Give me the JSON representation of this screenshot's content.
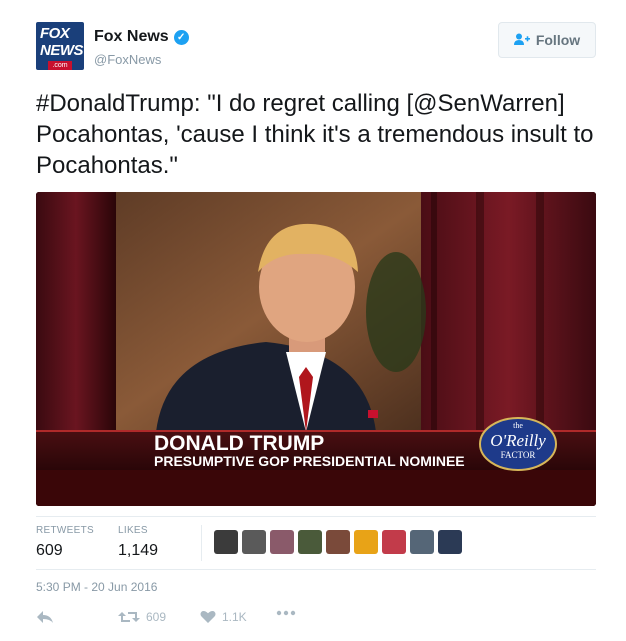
{
  "account": {
    "name": "Fox News",
    "handle": "@FoxNews",
    "logo_text": [
      "FOX",
      "NEWS",
      ".com"
    ]
  },
  "follow_label": "Follow",
  "tweet_text": "#DonaldTrump: \"I do regret calling [@SenWarren] Pocahontas, 'cause I think it's a tremendous insult to Pocahontas.\"",
  "media": {
    "lower_third_name": "DONALD TRUMP",
    "lower_third_title": "PRESUMPTIVE GOP PRESIDENTIAL NOMINEE",
    "show_logo_top": "the",
    "show_logo_main": "O'Reilly",
    "show_logo_sub": "FACTOR"
  },
  "stats": {
    "retweets_label": "RETWEETS",
    "retweets_value": "609",
    "likes_label": "LIKES",
    "likes_value": "1,149"
  },
  "avatar_colors": [
    "#3b3b3b",
    "#5a5a5a",
    "#8a5a6a",
    "#4a5a3a",
    "#7a4a3a",
    "#e8a317",
    "#c23b4a",
    "#556677",
    "#2b3a55"
  ],
  "timestamp": "5:30 PM - 20 Jun 2016",
  "actions": {
    "retweet_count": "609",
    "like_count": "1.1K"
  },
  "colors": {
    "accent": "#1da1f2",
    "muted": "#8899a6"
  }
}
